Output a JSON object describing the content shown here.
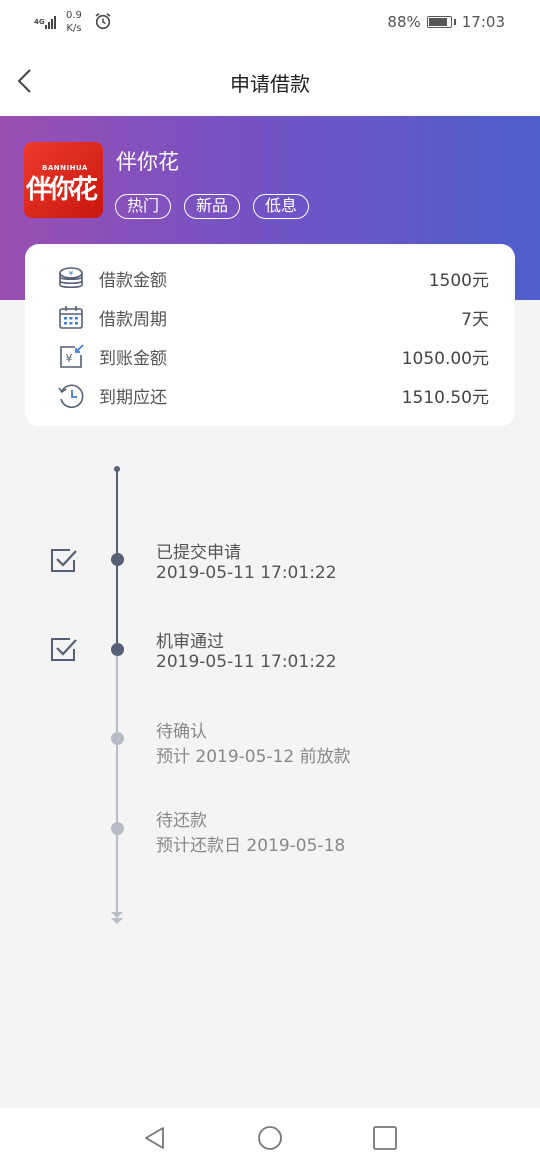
{
  "status_bar": {
    "network": "4G",
    "speed_value": "0.9",
    "speed_unit": "K/s",
    "battery": "88%",
    "time": "17:03",
    "icons": [
      "signal-icon",
      "alarm-icon",
      "battery-icon"
    ]
  },
  "header": {
    "title": "申请借款",
    "back_icon": "chevron-left-icon"
  },
  "product": {
    "logo_en": "BANNIHUA",
    "logo_cn": "伴你花",
    "name": "伴你花",
    "tags": [
      "热门",
      "新品",
      "低息"
    ]
  },
  "loan_info": [
    {
      "icon": "coins-icon",
      "label": "借款金额",
      "value": "1500元"
    },
    {
      "icon": "calendar-icon",
      "label": "借款周期",
      "value": "7天"
    },
    {
      "icon": "yuan-transfer-icon",
      "label": "到账金额",
      "value": "1050.00元"
    },
    {
      "icon": "clock-back-icon",
      "label": "到期应还",
      "value": "1510.50元"
    }
  ],
  "timeline": [
    {
      "title": "已提交申请",
      "subtitle": "2019-05-11 17:01:22",
      "status": "done"
    },
    {
      "title": "机审通过",
      "subtitle": "2019-05-11 17:01:22",
      "status": "done"
    },
    {
      "title": "待确认",
      "subtitle": "预计 2019-05-12 前放款",
      "status": "pending"
    },
    {
      "title": "待还款",
      "subtitle": "预计还款日 2019-05-18",
      "status": "pending"
    }
  ],
  "colors": {
    "gradient_start": "#9a4fb2",
    "gradient_end": "#4f5ecd",
    "timeline_done": "#555f75",
    "timeline_pending": "#b7bcc6",
    "accent_blue": "#3d7fd6"
  },
  "navbar": {
    "icons": [
      "back-triangle-icon",
      "home-circle-icon",
      "recents-square-icon"
    ]
  }
}
